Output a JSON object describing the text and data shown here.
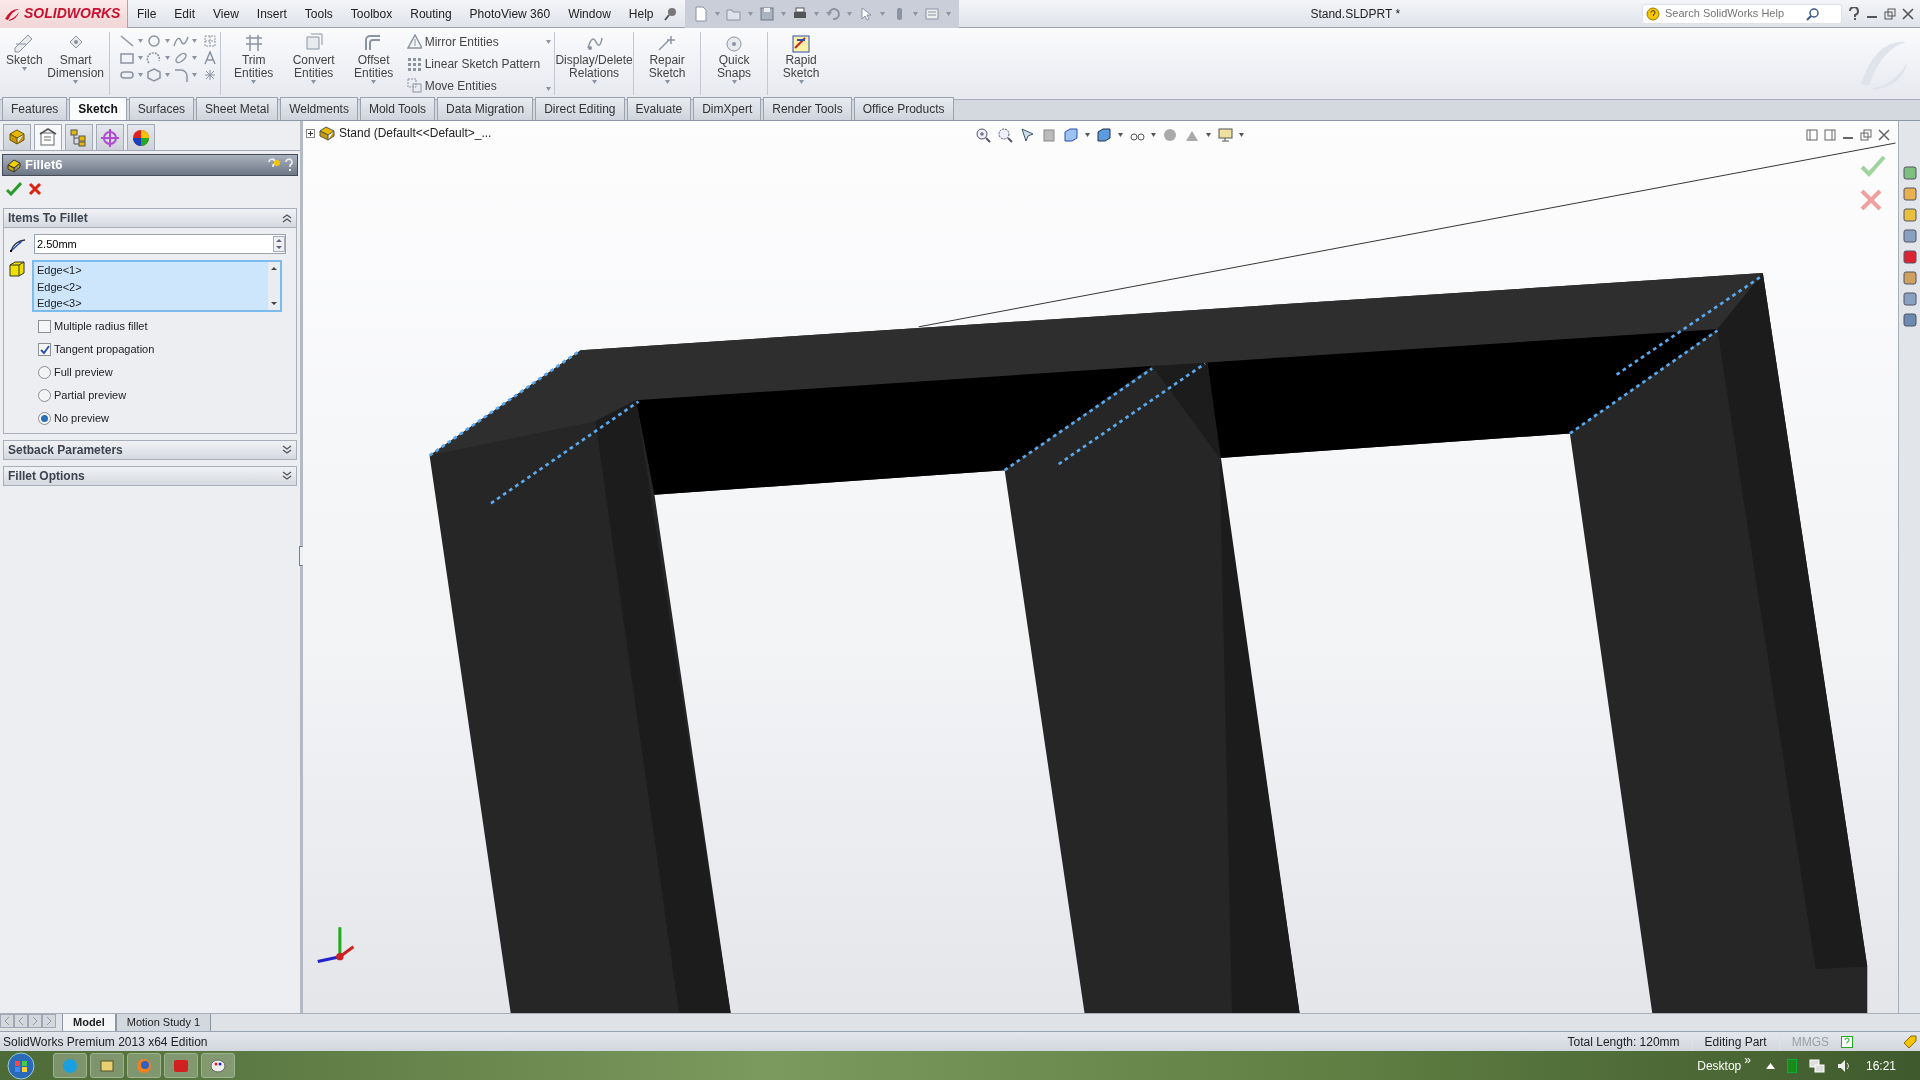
{
  "app": {
    "logo": "SOLIDWORKS",
    "document_title": "Stand.SLDPRT *"
  },
  "menu": [
    "File",
    "Edit",
    "View",
    "Insert",
    "Tools",
    "Toolbox",
    "Routing",
    "PhotoView 360",
    "Window",
    "Help"
  ],
  "help_search": {
    "placeholder": "Search SolidWorks Help"
  },
  "commands": [
    {
      "kind": "large",
      "label": "Sketch"
    },
    {
      "kind": "large",
      "label": "Smart Dimension"
    },
    {
      "kind": "tools"
    },
    {
      "kind": "large",
      "label": "Trim Entities"
    },
    {
      "kind": "large",
      "label": "Convert Entities"
    },
    {
      "kind": "large",
      "label": "Offset Entities"
    },
    {
      "kind": "stack",
      "items": [
        "Mirror Entities",
        "Linear Sketch Pattern",
        "Move Entities"
      ]
    },
    {
      "kind": "large",
      "label": "Display/Delete Relations"
    },
    {
      "kind": "large",
      "label": "Repair Sketch"
    },
    {
      "kind": "large",
      "label": "Quick Snaps"
    },
    {
      "kind": "large",
      "label": "Rapid Sketch"
    }
  ],
  "tabs": [
    {
      "label": "Features",
      "selected": false
    },
    {
      "label": "Sketch",
      "selected": true
    },
    {
      "label": "Surfaces",
      "selected": false
    },
    {
      "label": "Sheet Metal",
      "selected": false
    },
    {
      "label": "Weldments",
      "selected": false
    },
    {
      "label": "Mold Tools",
      "selected": false
    },
    {
      "label": "Data Migration",
      "selected": false
    },
    {
      "label": "Direct Editing",
      "selected": false
    },
    {
      "label": "Evaluate",
      "selected": false
    },
    {
      "label": "DimXpert",
      "selected": false
    },
    {
      "label": "Render Tools",
      "selected": false
    },
    {
      "label": "Office Products",
      "selected": false
    }
  ],
  "panel_tabs": [
    {
      "selected": false
    },
    {
      "selected": true
    },
    {
      "selected": false
    },
    {
      "selected": false
    },
    {
      "selected": false
    }
  ],
  "property_manager": {
    "title": "Fillet6",
    "sections": [
      {
        "title": "Items To Fillet",
        "expanded": true
      },
      {
        "title": "Setback Parameters",
        "expanded": false
      },
      {
        "title": "Fillet Options",
        "expanded": false
      }
    ],
    "radius": {
      "value": "2.50mm"
    },
    "edges": [
      "Edge<1>",
      "Edge<2>",
      "Edge<3>"
    ],
    "options": [
      {
        "kind": "checkbox",
        "label": "Multiple radius fillet",
        "checked": false
      },
      {
        "kind": "checkbox",
        "label": "Tangent propagation",
        "checked": true
      },
      {
        "kind": "radio",
        "label": "Full preview",
        "selected": false
      },
      {
        "kind": "radio",
        "label": "Partial preview",
        "selected": false
      },
      {
        "kind": "radio",
        "label": "No preview",
        "selected": true
      }
    ]
  },
  "tree": {
    "root": "Stand  (Default<<Default>_..."
  },
  "bottom_tabs": [
    {
      "label": "Model",
      "selected": true
    },
    {
      "label": "Motion Study 1",
      "selected": false
    }
  ],
  "status_bar": {
    "edition": "SolidWorks Premium 2013 x64 Edition",
    "total_length": "Total Length: 120mm",
    "mode": "Editing Part",
    "units": "MMGS"
  },
  "taskbar": {
    "desktop": "Desktop",
    "chevron": "»",
    "clock": "16:21"
  }
}
